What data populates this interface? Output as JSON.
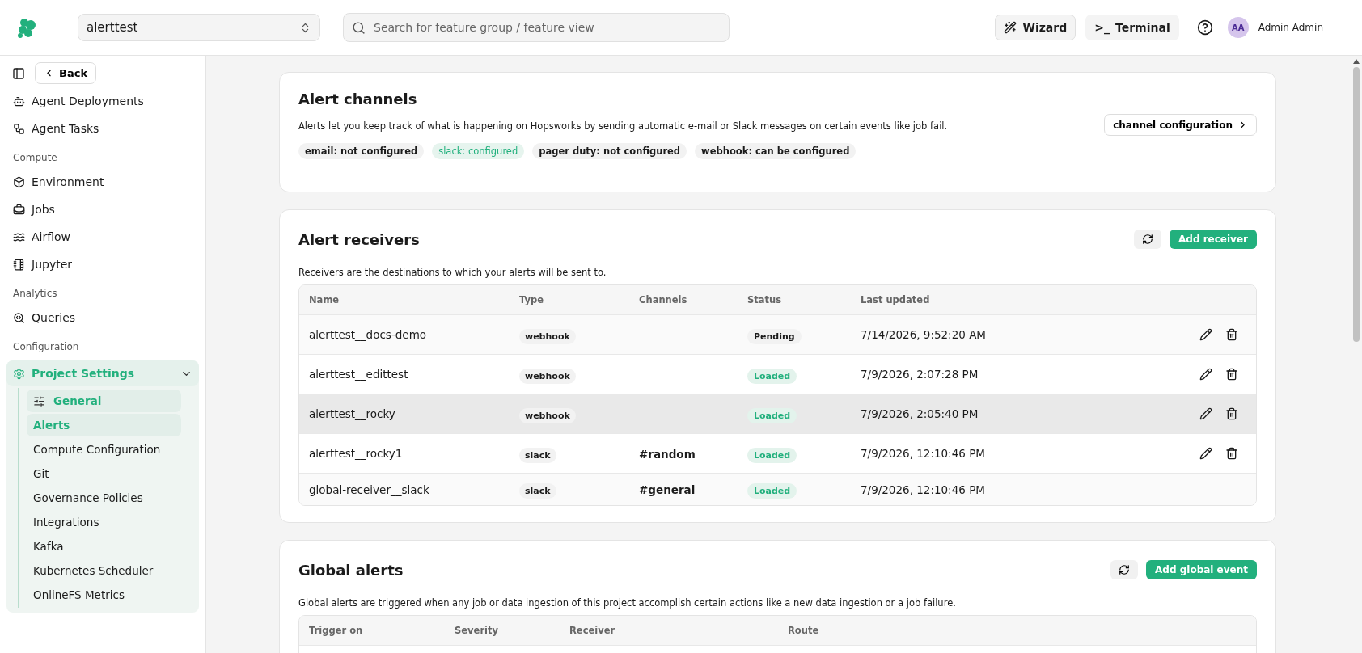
{
  "header": {
    "project": "alerttest",
    "search_placeholder": "Search for feature group / feature view",
    "wizard": "Wizard",
    "terminal_prompt": ">_",
    "terminal": "Terminal",
    "avatar_initials": "AA",
    "user": "Admin Admin"
  },
  "sidebar": {
    "back": "Back",
    "top_items": [
      {
        "label": "Agent Deployments",
        "selected": false
      },
      {
        "label": "Agent Tasks",
        "selected": false
      }
    ],
    "sections": [
      {
        "title": "Compute",
        "items": [
          {
            "label": "Environment",
            "selected": false
          },
          {
            "label": "Jobs",
            "selected": false
          },
          {
            "label": "Airflow",
            "selected": false
          },
          {
            "label": "Jupyter",
            "selected": false
          }
        ]
      },
      {
        "title": "Analytics",
        "items": [
          {
            "label": "Queries",
            "selected": false
          }
        ]
      },
      {
        "title": "Configuration"
      }
    ],
    "settings": {
      "label": "Project Settings",
      "expanded": true,
      "children": [
        {
          "label": "General",
          "selected": true
        },
        {
          "label": "Alerts",
          "selected": true
        },
        {
          "label": "Compute Configuration",
          "selected": false
        },
        {
          "label": "Git",
          "selected": false
        },
        {
          "label": "Governance Policies",
          "selected": false
        },
        {
          "label": "Integrations",
          "selected": false
        },
        {
          "label": "Kafka",
          "selected": false
        },
        {
          "label": "Kubernetes Scheduler",
          "selected": false
        },
        {
          "label": "OnlineFS Metrics",
          "selected": false
        }
      ]
    }
  },
  "channels_card": {
    "title": "Alert channels",
    "description": "Alerts let you keep track of what is happening on Hopsworks by sending automatic e-mail or Slack messages on certain events like job fail.",
    "button": "channel configuration",
    "tags": [
      {
        "label": "email: not configured",
        "configured": false
      },
      {
        "label": "slack: configured",
        "configured": true
      },
      {
        "label": "pager duty: not configured",
        "configured": false
      },
      {
        "label": "webhook: can be configured",
        "configured": false
      }
    ]
  },
  "receivers_card": {
    "title": "Alert receivers",
    "add_button": "Add receiver",
    "description": "Receivers are the destinations to which your alerts will be sent to.",
    "columns": [
      "Name",
      "Type",
      "Channels",
      "Status",
      "Last updated"
    ],
    "rows": [
      {
        "name": "alerttest__docs-demo",
        "type": "webhook",
        "channel": "",
        "status": "Pending",
        "loaded": false,
        "updated": "7/14/2026, 9:52:20 AM",
        "editable": true,
        "hovered": false
      },
      {
        "name": "alerttest__edittest",
        "type": "webhook",
        "channel": "",
        "status": "Loaded",
        "loaded": true,
        "updated": "7/9/2026, 2:07:28 PM",
        "editable": true,
        "hovered": false
      },
      {
        "name": "alerttest__rocky",
        "type": "webhook",
        "channel": "",
        "status": "Loaded",
        "loaded": true,
        "updated": "7/9/2026, 2:05:40 PM",
        "editable": true,
        "hovered": true
      },
      {
        "name": "alerttest__rocky1",
        "type": "slack",
        "channel": "#random",
        "status": "Loaded",
        "loaded": true,
        "updated": "7/9/2026, 12:10:46 PM",
        "editable": true,
        "hovered": false
      },
      {
        "name": "global-receiver__slack",
        "type": "slack",
        "channel": "#general",
        "status": "Loaded",
        "loaded": true,
        "updated": "7/9/2026, 12:10:46 PM",
        "editable": false,
        "hovered": false
      }
    ]
  },
  "global_card": {
    "title": "Global alerts",
    "add_button": "Add global event",
    "description": "Global alerts are triggered when any job or data ingestion of this project accomplish certain actions like a new data ingestion or a job failure.",
    "columns": [
      "Trigger on",
      "Severity",
      "Receiver",
      "Route"
    ]
  }
}
